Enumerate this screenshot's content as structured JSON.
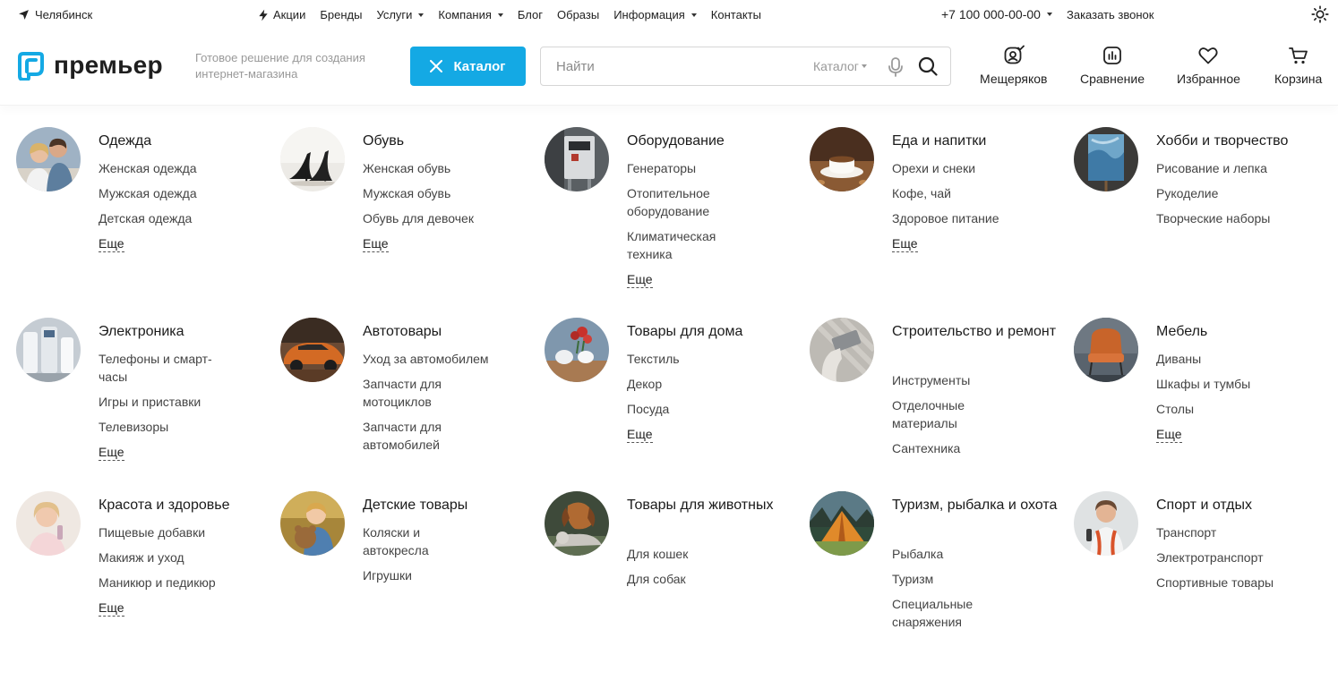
{
  "topbar": {
    "city": "Челябинск",
    "nav": [
      {
        "label": "Акции",
        "icon": "lightning-icon",
        "dropdown": false
      },
      {
        "label": "Бренды",
        "dropdown": false
      },
      {
        "label": "Услуги",
        "dropdown": true
      },
      {
        "label": "Компания",
        "dropdown": true
      },
      {
        "label": "Блог",
        "dropdown": false
      },
      {
        "label": "Образы",
        "dropdown": false
      },
      {
        "label": "Информация",
        "dropdown": true
      },
      {
        "label": "Контакты",
        "dropdown": false
      }
    ],
    "phone": "+7 100 000-00-00",
    "callback": "Заказать звонок"
  },
  "header": {
    "logo_text": "премьер",
    "tagline": "Готовое решение для создания интернет-магазина",
    "catalog_button": "Каталог",
    "search": {
      "placeholder": "Найти",
      "scope": "Каталог"
    },
    "icons": {
      "profile": "Мещеряков",
      "compare": "Сравнение",
      "favorites": "Избранное",
      "cart": "Корзина"
    }
  },
  "catalog": {
    "more_label": "Еще",
    "rows": [
      [
        {
          "title": "Одежда",
          "image": "people-couple",
          "items": [
            "Женская одежда",
            "Мужская одежда",
            "Детская одежда"
          ],
          "more": true
        },
        {
          "title": "Обувь",
          "image": "high-heels",
          "items": [
            "Женская обувь",
            "Мужская обувь",
            "Обувь для девочек"
          ],
          "more": true
        },
        {
          "title": "Оборудование",
          "image": "generator",
          "items": [
            "Генераторы",
            "Отопительное оборудование",
            "Климатическая техника"
          ],
          "more": true
        },
        {
          "title": "Еда и напитки",
          "image": "coffee-cup",
          "items": [
            "Орехи и снеки",
            "Кофе, чай",
            "Здоровое питание"
          ],
          "more": true
        },
        {
          "title": "Хобби и творчество",
          "image": "canvas-painting",
          "items": [
            "Рисование и лепка",
            "Рукоделие",
            "Творческие наборы"
          ],
          "more": false
        }
      ],
      [
        {
          "title": "Электроника",
          "image": "devices",
          "items": [
            "Телефоны и смарт-часы",
            "Игры и приставки",
            "Телевизоры"
          ],
          "more": true
        },
        {
          "title": "Автотовары",
          "image": "car",
          "items": [
            "Уход за автомобилем",
            "Запчасти для мотоциклов",
            "Запчасти для автомобилей"
          ],
          "more": false
        },
        {
          "title": "Товары для дома",
          "image": "tableware",
          "items": [
            "Текстиль",
            "Декор",
            "Посуда"
          ],
          "more": true
        },
        {
          "title": "Строительство и ремонт",
          "image": "plastering",
          "items": [
            "Инструменты",
            "Отделочные материалы",
            "Сантехника"
          ],
          "more": false
        },
        {
          "title": "Мебель",
          "image": "armchair",
          "items": [
            "Диваны",
            "Шкафы и тумбы",
            "Столы"
          ],
          "more": true
        }
      ],
      [
        {
          "title": "Красота и здоровье",
          "image": "woman-cosmetics",
          "items": [
            "Пищевые добавки",
            "Макияж и уход",
            "Маникюр и педикюр"
          ],
          "more": true
        },
        {
          "title": "Детские товары",
          "image": "child-teddy",
          "items": [
            "Коляски и автокресла",
            "Игрушки"
          ],
          "more": false
        },
        {
          "title": "Товары для животных",
          "image": "dog-cat",
          "items": [
            "Для кошек",
            "Для собак"
          ],
          "more": false
        },
        {
          "title": "Туризм, рыбалка и охота",
          "image": "tent",
          "items": [
            "Рыбалка",
            "Туризм",
            "Специальные снаряжения"
          ],
          "more": false
        },
        {
          "title": "Спорт и отдых",
          "image": "athlete",
          "items": [
            "Транспорт",
            "Электротранспорт",
            "Спортивные товары"
          ],
          "more": false
        }
      ]
    ]
  }
}
